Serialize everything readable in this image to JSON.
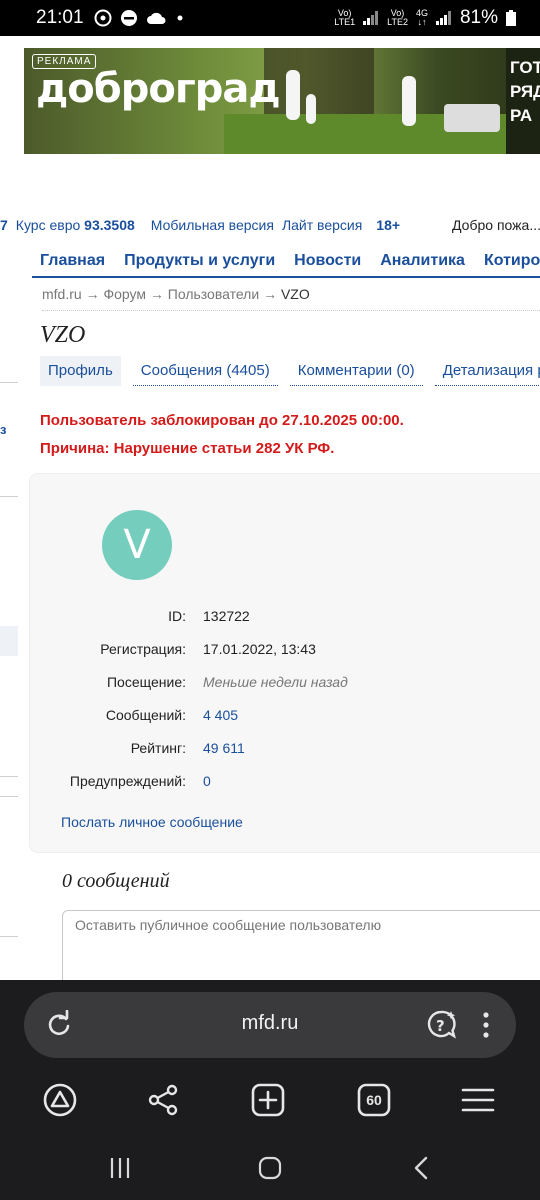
{
  "status_bar": {
    "time": "21:01",
    "battery": "81%",
    "icons": [
      "whatsapp-icon",
      "dnd-icon",
      "cloud-icon",
      "dot-icon",
      "volte-lte1-icon",
      "signal-icon",
      "volte-lte2-icon",
      "4g-icon",
      "signal-icon",
      "battery-icon"
    ]
  },
  "ad": {
    "tag": "РЕКЛАМА",
    "brand": "доброград",
    "side_text": [
      "ГОТ",
      "РЯД",
      "РА"
    ]
  },
  "topline": {
    "cut_value": "7",
    "euro_label": "Курс евро",
    "euro_value": "93.3508",
    "mobile": "Мобильная версия",
    "lite": "Лайт версия",
    "age": "18+",
    "welcome": "Добро пожа..."
  },
  "nav": {
    "items": [
      "Главная",
      "Продукты и услуги",
      "Новости",
      "Аналитика",
      "Котировки"
    ]
  },
  "breadcrumb": {
    "items": [
      "mfd.ru",
      "Форум",
      "Пользователи"
    ],
    "separator": "→",
    "current": "VZO"
  },
  "profile": {
    "username": "VZO",
    "tabs": [
      "Профиль",
      "Сообщения (4405)",
      "Комментарии (0)",
      "Детализация рейтинга"
    ],
    "ban_notice": "Пользователь заблокирован до 27.10.2025 00:00.",
    "ban_reason": "Причина: Нарушение статьи 282 УК РФ.",
    "avatar_letter": "V",
    "avatar_color": "#75cdbd",
    "fields": {
      "id_label": "ID:",
      "id_value": "132722",
      "reg_label": "Регистрация:",
      "reg_value": "17.01.2022, 13:43",
      "visit_label": "Посещение:",
      "visit_value": "Меньше недели назад",
      "msgs_label": "Сообщений:",
      "msgs_value": "4 405",
      "rating_label": "Рейтинг:",
      "rating_value": "49 611",
      "warn_label": "Предупреждений:",
      "warn_value": "0"
    },
    "pm_link": "Послать личное сообщение"
  },
  "wall": {
    "title": "0 сообщений",
    "placeholder": "Оставить публичное сообщение пользователю"
  },
  "sidebar": {
    "fragment": "з"
  },
  "browser": {
    "url": "mfd.ru",
    "tabs_count": "60"
  },
  "colors": {
    "link": "#1a4f9c",
    "error": "#d51a1a",
    "browser_bg": "#1c1c1e"
  }
}
